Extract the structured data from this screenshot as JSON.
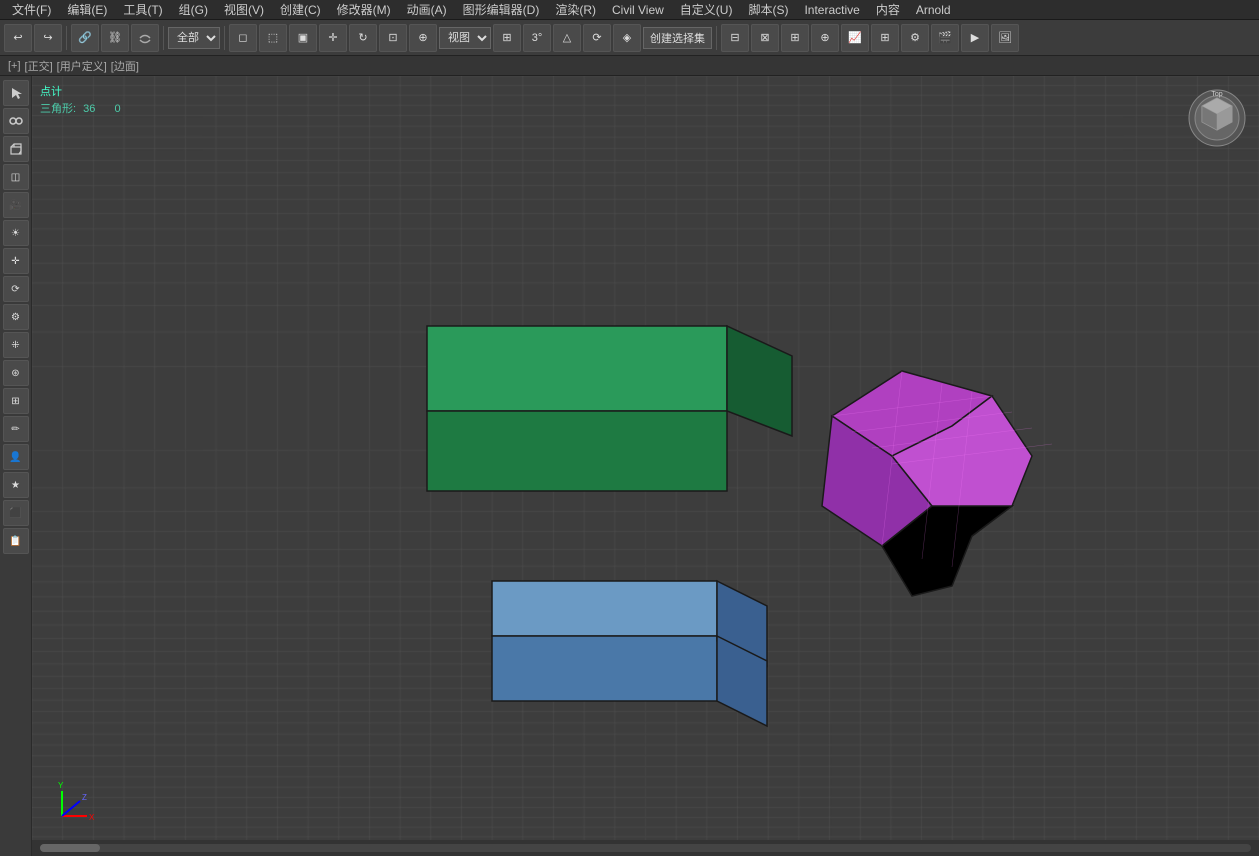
{
  "menubar": {
    "items": [
      {
        "label": "文件(F)"
      },
      {
        "label": "编辑(E)"
      },
      {
        "label": "工具(T)"
      },
      {
        "label": "组(G)"
      },
      {
        "label": "视图(V)"
      },
      {
        "label": "创建(C)"
      },
      {
        "label": "修改器(M)"
      },
      {
        "label": "动画(A)"
      },
      {
        "label": "图形编辑器(D)"
      },
      {
        "label": "渲染(R)"
      },
      {
        "label": "Civil View"
      },
      {
        "label": "自定义(U)"
      },
      {
        "label": "脚本(S)"
      },
      {
        "label": "Interactive"
      },
      {
        "label": "内容"
      },
      {
        "label": "Arnold"
      }
    ]
  },
  "toolbar": {
    "dropdown_all": "全部",
    "dropdown_view": "视图",
    "create_select_label": "创建选择集"
  },
  "infobar": {
    "mode": "[+]",
    "view_type": "[正交]",
    "user_defined": "[用户定义]",
    "edge_mode": "[边面]"
  },
  "stats": {
    "title": "点计",
    "triangle_label": "三角形:",
    "triangle_count": "36",
    "triangle_value": "0"
  },
  "viewport": {
    "label": ""
  }
}
